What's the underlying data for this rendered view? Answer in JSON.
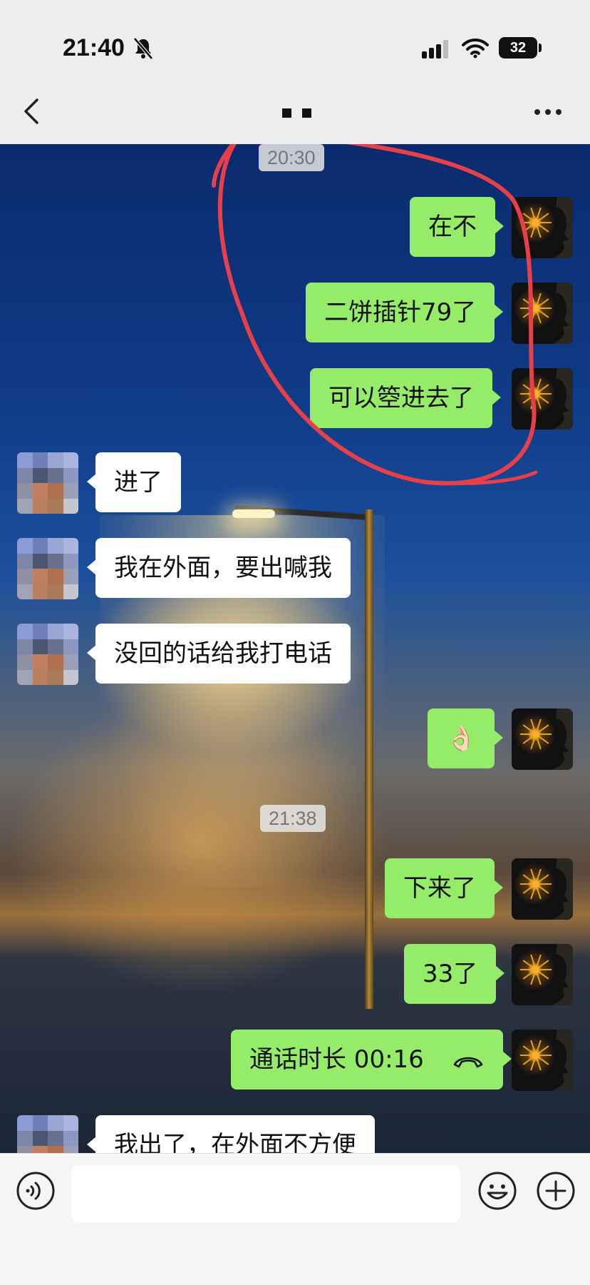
{
  "status_bar": {
    "time": "21:40",
    "battery": "32",
    "icons": [
      "bell-off-icon",
      "signal-icon",
      "wifi-icon",
      "battery-icon"
    ]
  },
  "nav": {
    "back_icon": "chevron-left-icon",
    "title": "",
    "more_icon": "ellipsis-icon"
  },
  "timestamps": [
    "20:30",
    "21:38"
  ],
  "messages": [
    {
      "side": "out",
      "text": "在不"
    },
    {
      "side": "out",
      "text": "二饼插针79了"
    },
    {
      "side": "out",
      "text": "可以箜进去了"
    },
    {
      "side": "in",
      "text": "进了"
    },
    {
      "side": "in",
      "text": "我在外面，要出喊我"
    },
    {
      "side": "in",
      "text": "没回的话给我打电话"
    },
    {
      "side": "out",
      "text": "👌🏻"
    },
    {
      "side": "out",
      "text": "下来了"
    },
    {
      "side": "out",
      "text": "33了"
    },
    {
      "side": "out",
      "text": "通话时长 00:16",
      "icon": "phone-hangup-icon"
    },
    {
      "side": "in",
      "text": "我出了，在外面不方便"
    }
  ],
  "input_bar": {
    "voice_icon": "voice-icon",
    "placeholder": "",
    "emoji_icon": "emoji-icon",
    "plus_icon": "plus-icon"
  },
  "colors": {
    "outgoing_bubble": "#95ec69",
    "incoming_bubble": "#ffffff",
    "annotation": "#e8404a"
  }
}
